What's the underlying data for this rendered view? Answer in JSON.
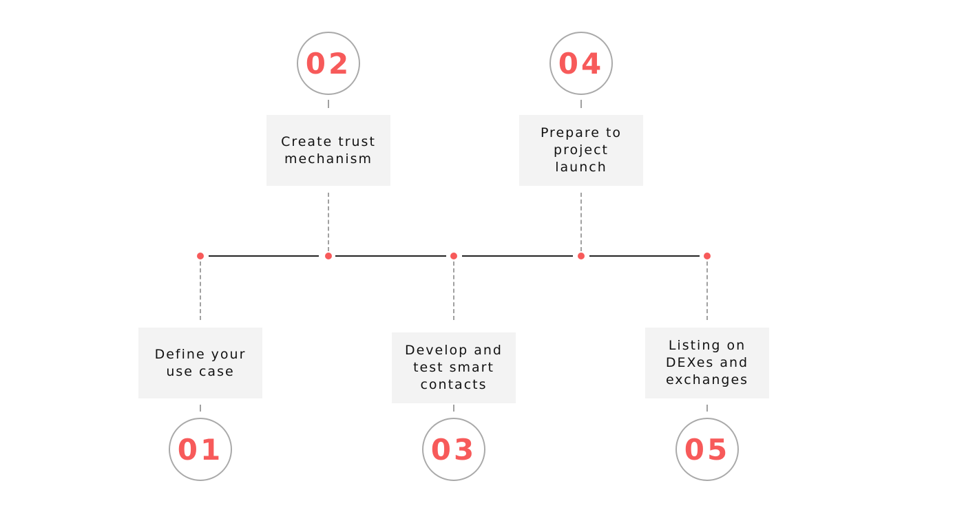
{
  "accent_color": "#f75a5a",
  "steps": [
    {
      "number": "01",
      "label": "Define your use case",
      "position": "below"
    },
    {
      "number": "02",
      "label": "Create trust mechanism",
      "position": "above"
    },
    {
      "number": "03",
      "label": "Develop and test smart contacts",
      "position": "below"
    },
    {
      "number": "04",
      "label": "Prepare to project launch",
      "position": "above"
    },
    {
      "number": "05",
      "label": "Listing on DEXes and exchanges",
      "position": "below"
    }
  ]
}
